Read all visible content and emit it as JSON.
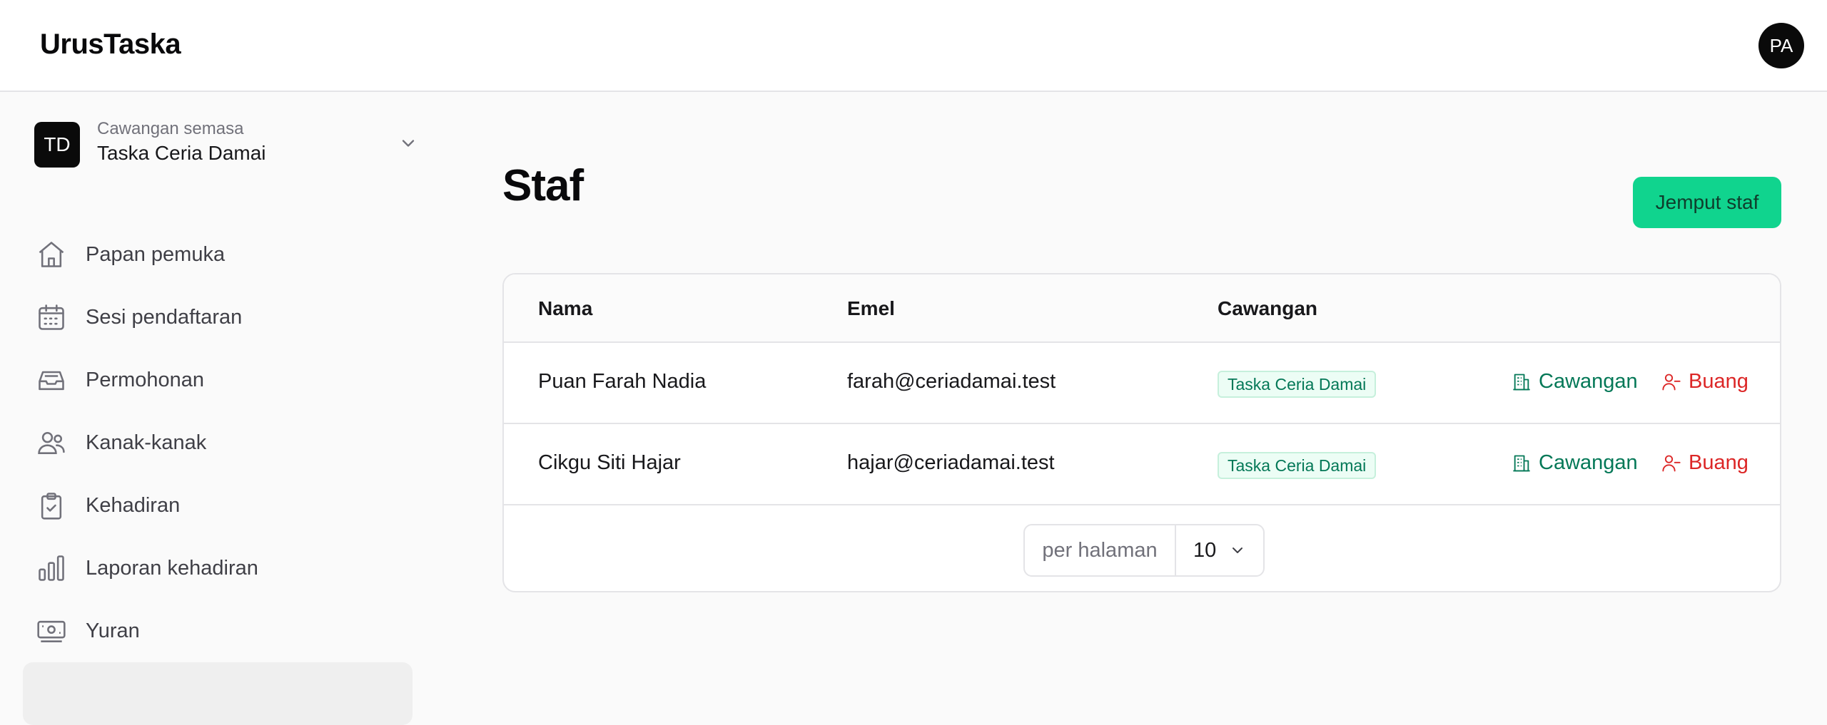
{
  "app": {
    "brand": "UrusTaska",
    "user_initials": "PA"
  },
  "branch": {
    "caption": "Cawangan semasa",
    "name": "Taska Ceria Damai",
    "initials": "TD"
  },
  "sidebar": {
    "items": [
      {
        "label": "Papan pemuka",
        "icon": "home-icon"
      },
      {
        "label": "Sesi pendaftaran",
        "icon": "calendar-icon"
      },
      {
        "label": "Permohonan",
        "icon": "inbox-icon"
      },
      {
        "label": "Kanak-kanak",
        "icon": "users-icon"
      },
      {
        "label": "Kehadiran",
        "icon": "clipboard-check-icon"
      },
      {
        "label": "Laporan kehadiran",
        "icon": "bar-chart-icon"
      },
      {
        "label": "Yuran",
        "icon": "banknote-icon"
      }
    ]
  },
  "page": {
    "title": "Staf",
    "invite_label": "Jemput staf"
  },
  "table": {
    "headers": {
      "name": "Nama",
      "email": "Emel",
      "branch": "Cawangan"
    },
    "rows": [
      {
        "name": "Puan Farah Nadia",
        "email": "farah@ceriadamai.test",
        "branch": "Taska Ceria Damai",
        "action_branch": "Cawangan",
        "action_remove": "Buang"
      },
      {
        "name": "Cikgu Siti Hajar",
        "email": "hajar@ceriadamai.test",
        "branch": "Taska Ceria Damai",
        "action_branch": "Cawangan",
        "action_remove": "Buang"
      }
    ]
  },
  "pagination": {
    "per_page_label": "per halaman",
    "per_page_value": "10"
  },
  "colors": {
    "accent": "#10d48e",
    "success_text": "#047857",
    "danger": "#dc2626"
  }
}
